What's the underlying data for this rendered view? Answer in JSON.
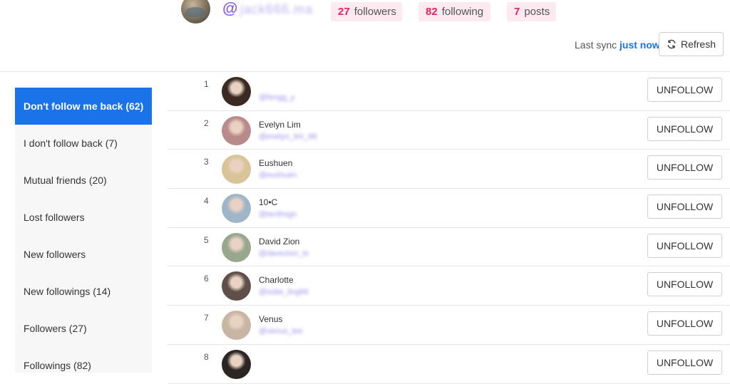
{
  "profile": {
    "at": "@",
    "username": "jack666.ma"
  },
  "stats": {
    "followers": {
      "num": "27",
      "label": "followers"
    },
    "following": {
      "num": "82",
      "label": "following"
    },
    "posts": {
      "num": "7",
      "label": "posts"
    }
  },
  "sync": {
    "prefix": "Last sync",
    "when": "just now",
    "refresh_label": "Refresh"
  },
  "sidebar": {
    "items": [
      {
        "label": "Don't follow me back (62)"
      },
      {
        "label": "I don't follow back (7)"
      },
      {
        "label": "Mutual friends (20)"
      },
      {
        "label": "Lost followers"
      },
      {
        "label": "New followers"
      },
      {
        "label": "New followings (14)"
      },
      {
        "label": "Followers (27)"
      },
      {
        "label": "Followings (82)"
      }
    ]
  },
  "rows": [
    {
      "index": "1",
      "name": "",
      "handle": "@fengg_y",
      "button": "UNFOLLOW",
      "avatar_color": "#3b2a24"
    },
    {
      "index": "2",
      "name": "Evelyn Lim",
      "handle": "@evelyn_lim_88",
      "button": "UNFOLLOW",
      "avatar_color": "#b98a8a"
    },
    {
      "index": "3",
      "name": "Eushuen",
      "handle": "@eushuen",
      "button": "UNFOLLOW",
      "avatar_color": "#d9c49a"
    },
    {
      "index": "4",
      "name": "10•C",
      "handle": "@tenthsgn",
      "button": "UNFOLLOW",
      "avatar_color": "#9fb6c9"
    },
    {
      "index": "5",
      "name": "David Zion",
      "handle": "@davezion_ts",
      "button": "UNFOLLOW",
      "avatar_color": "#9aa78f"
    },
    {
      "index": "6",
      "name": "Charlotte",
      "handle": "@ssbe_ling66",
      "button": "UNFOLLOW",
      "avatar_color": "#5e5048"
    },
    {
      "index": "7",
      "name": "Venus",
      "handle": "@venus_lee",
      "button": "UNFOLLOW",
      "avatar_color": "#c9b5a4"
    },
    {
      "index": "8",
      "name": "",
      "handle": "",
      "button": "UNFOLLOW",
      "avatar_color": "#2b2523"
    }
  ]
}
